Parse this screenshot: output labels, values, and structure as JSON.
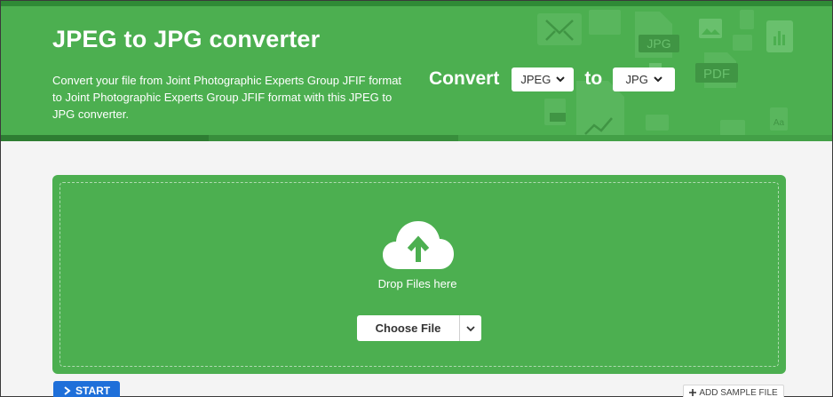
{
  "header": {
    "title": "JPEG to JPG converter",
    "description": "Convert your file from Joint Photographic Experts Group JFIF format to Joint Photographic Experts Group JFIF format with this JPEG to JPG converter.",
    "convert_label": "Convert",
    "to_label": "to",
    "from_format": "JPEG",
    "to_format": "JPG",
    "deco_labels": {
      "jpg": "JPG",
      "pdf": "PDF",
      "font": "Aa"
    }
  },
  "dropzone": {
    "drop_text": "Drop Files here",
    "choose_label": "Choose File"
  },
  "actions": {
    "start_label": "START",
    "sample_label": "ADD SAMPLE FILE"
  },
  "colors": {
    "brand_green": "#4caf50",
    "start_blue": "#1e6fd9"
  }
}
